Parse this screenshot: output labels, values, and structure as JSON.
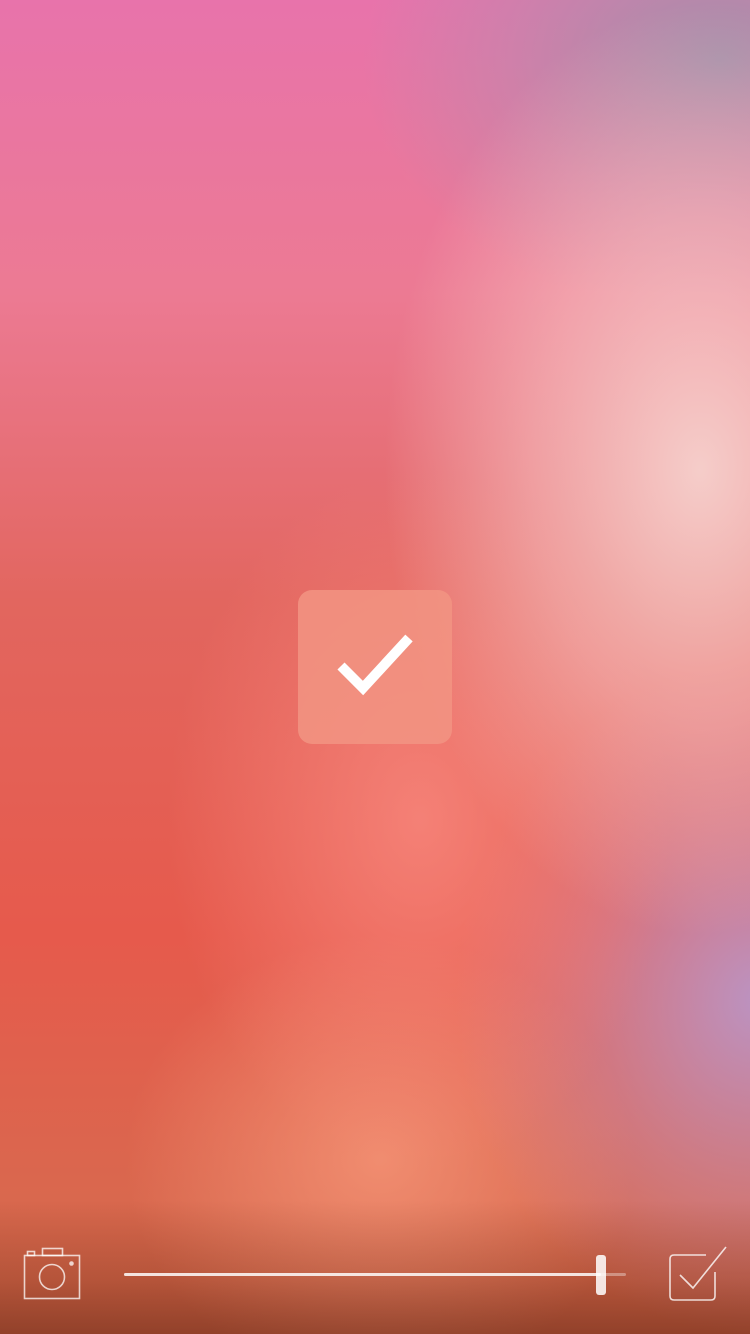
{
  "screen": {
    "background": {
      "top_left": "#e873ab",
      "top_right": "#a596aa",
      "center_right": "#f3cbc8",
      "bottom_left": "#e65a4c",
      "bottom_right": "#c196c0"
    }
  },
  "overlay": {
    "icon": "checkmark-icon",
    "badge_color": "#f29482",
    "icon_color": "#ffffff"
  },
  "toolbar": {
    "left_icon": "camera-icon",
    "right_icon": "checkbox-checked-icon",
    "slider": {
      "value": 0.95,
      "track_color": "#ffffff"
    }
  }
}
